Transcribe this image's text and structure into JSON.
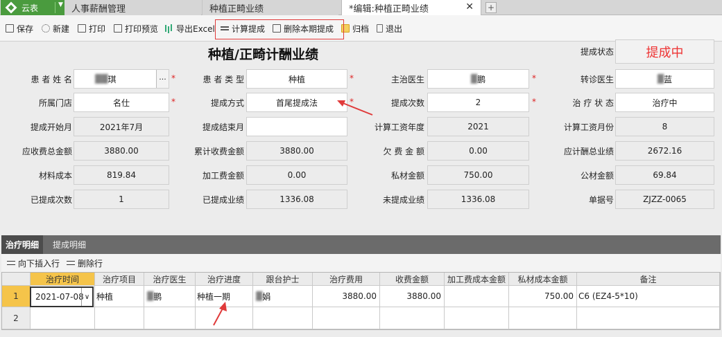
{
  "app": {
    "name": "云表"
  },
  "tabs": [
    {
      "label": "人事薪酬管理"
    },
    {
      "label": "种植正畸业绩"
    },
    {
      "label": "*编辑:种植正畸业绩"
    }
  ],
  "toolbar": {
    "save": "保存",
    "new": "新建",
    "print": "打印",
    "print_preview": "打印预览",
    "export_excel": "导出Excel",
    "calc_commission": "计算提成",
    "delete_period": "删除本期提成",
    "archive": "归档",
    "exit": "退出"
  },
  "form": {
    "title": "种植/正畸计酬业绩",
    "status_label": "提成状态",
    "status_value": "提成中",
    "patient_name_label": "患 者 姓 名",
    "patient_name_value": "琪",
    "patient_type_label": "患 者 类 型",
    "patient_type_value": "种植",
    "doctor_label": "主治医生",
    "doctor_value": "鹏",
    "referral_doctor_label": "转诊医生",
    "referral_doctor_value": "蓝",
    "store_label": "所属门店",
    "store_value": "名仕",
    "method_label": "提成方式",
    "method_value": "首尾提成法",
    "times_label": "提成次数",
    "times_value": "2",
    "treat_status_label": "治 疗 状 态",
    "treat_status_value": "治疗中",
    "start_month_label": "提成开始月",
    "start_month_value": "2021年7月",
    "end_month_label": "提成结束月",
    "end_month_value": "",
    "salary_year_label": "计算工资年度",
    "salary_year_value": "2021",
    "salary_month_label": "计算工资月份",
    "salary_month_value": "8",
    "receivable_label": "应收费总金额",
    "receivable_value": "3880.00",
    "cum_receipt_label": "累计收费金额",
    "cum_receipt_value": "3880.00",
    "arrears_label": "欠 费 金 额",
    "arrears_value": "0.00",
    "payable_perf_label": "应计酬总业绩",
    "payable_perf_value": "2672.16",
    "material_label": "材料成本",
    "material_value": "819.84",
    "processing_label": "加工费金额",
    "processing_value": "0.00",
    "private_label": "私材金额",
    "private_value": "750.00",
    "public_label": "公材金额",
    "public_value": "69.84",
    "done_times_label": "已提成次数",
    "done_times_value": "1",
    "done_perf_label": "已提成业绩",
    "done_perf_value": "1336.08",
    "undone_perf_label": "未提成业绩",
    "undone_perf_value": "1336.08",
    "doc_no_label": "单据号",
    "doc_no_value": "ZJZZ-0065"
  },
  "detail": {
    "tab_active": "治疗明细",
    "tab_other": "提成明细",
    "insert_row": "向下插入行",
    "delete_row": "删除行",
    "columns": [
      "治疗时间",
      "治疗项目",
      "治疗医生",
      "治疗进度",
      "跟台护士",
      "治疗费用",
      "收费金额",
      "加工费成本金额",
      "私材成本金额",
      "备注"
    ],
    "rows": [
      {
        "num": "1",
        "date": "2021-07-08",
        "item": "种植",
        "doctor": "鹏",
        "progress": "种植一期",
        "nurse": "娟",
        "fee": "3880.00",
        "charge": "3880.00",
        "processing": "",
        "private_cost": "750.00",
        "note": "C6 (EZ4-5*10)"
      },
      {
        "num": "2",
        "date": "",
        "item": "",
        "doctor": "",
        "progress": "",
        "nurse": "",
        "fee": "",
        "charge": "",
        "processing": "",
        "private_cost": "",
        "note": ""
      }
    ]
  },
  "colors": {
    "accent_green": "#4a9b3e",
    "status_red": "#e33333",
    "annotation_red": "#e03a3a",
    "selected_cell": "#f5c44a"
  }
}
